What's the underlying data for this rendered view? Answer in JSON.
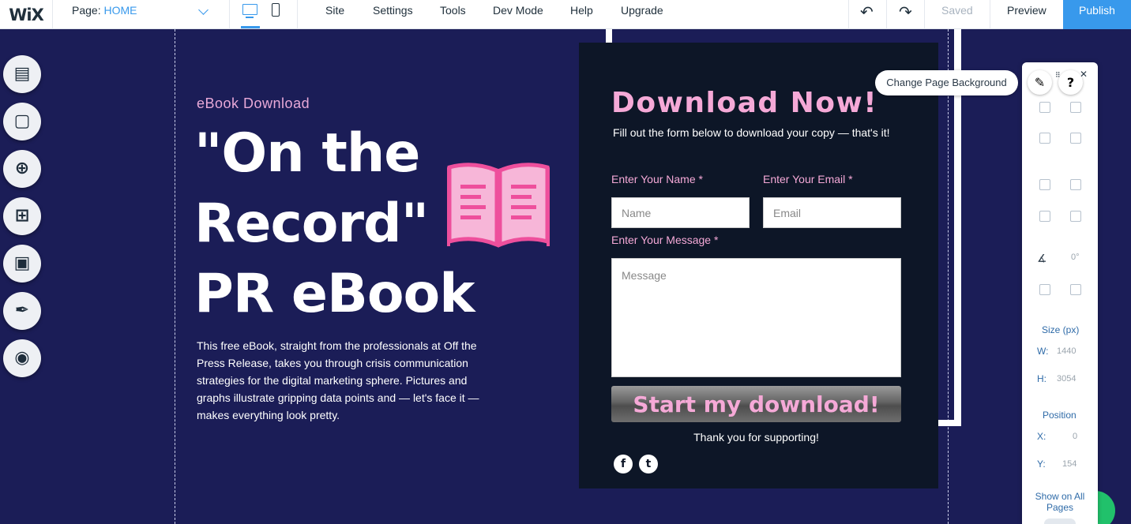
{
  "topbar": {
    "logo": "WiX",
    "page_label": "Page:",
    "page_name": "HOME",
    "menu": [
      "Site",
      "Settings",
      "Tools",
      "Dev Mode",
      "Help",
      "Upgrade"
    ],
    "saved": "Saved",
    "preview": "Preview",
    "publish": "Publish"
  },
  "left_toolbar": {
    "icons": [
      "pages-icon",
      "background-icon",
      "add-icon",
      "apps-icon",
      "media-icon",
      "blog-icon",
      "chat-icon"
    ]
  },
  "hero": {
    "subtitle": "eBook Download",
    "title_lines": [
      "\"On the",
      "Record\"",
      "PR eBook"
    ],
    "body": "This free eBook, straight from the professionals at Off the Press Release, takes you through crisis communication strategies for the digital marketing sphere. Pictures and graphs illustrate gripping data points and — let's face it — makes everything look pretty."
  },
  "form": {
    "title": "Download Now!",
    "subtitle": "Fill out the form below to download your copy — that's it!",
    "name_label": "Enter Your Name *",
    "name_placeholder": "Name",
    "email_label": "Enter Your Email *",
    "email_placeholder": "Email",
    "message_label": "Enter Your Message *",
    "message_placeholder": "Message",
    "submit": "Start my download!",
    "thanks": "Thank you for supporting!"
  },
  "inspector": {
    "tooltip": "Change Page Background",
    "rotation": "0°",
    "size_label": "Size (px)",
    "w_label": "W:",
    "w_value": "1440",
    "h_label": "H:",
    "h_value": "3054",
    "position_label": "Position",
    "x_label": "X:",
    "x_value": "0",
    "y_label": "Y:",
    "y_value": "154",
    "show_all_pages": "Show on All Pages"
  },
  "colors": {
    "canvas_bg": "#1b1d57",
    "form_bg": "#0d1627",
    "accent_pink": "#f5a9d7",
    "wix_blue": "#3899ec"
  }
}
